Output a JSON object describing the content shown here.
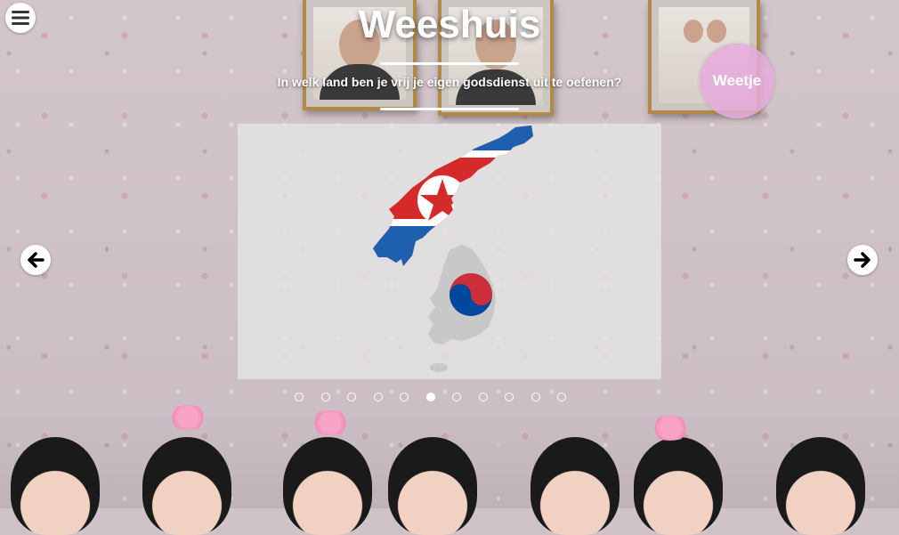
{
  "header": {
    "title": "Weeshuis",
    "question": "In welk land ben je vrij je eigen godsdienst uit te oefenen?"
  },
  "menu": {
    "icon": "hamburger-menu-icon"
  },
  "fact_button": {
    "label": "Weetje"
  },
  "navigation": {
    "prev_icon": "arrow-left-icon",
    "next_icon": "arrow-right-icon"
  },
  "pagination": {
    "total": 11,
    "active_index": 5
  },
  "map": {
    "north": {
      "flag_colors": [
        "#d42a2a",
        "#ffffff",
        "#1f5fb0"
      ],
      "star_color": "#d42a2a"
    },
    "south": {
      "fill": "#c8c8c8",
      "taeguk_colors": [
        "#cd2e3a",
        "#0047a0"
      ]
    }
  }
}
